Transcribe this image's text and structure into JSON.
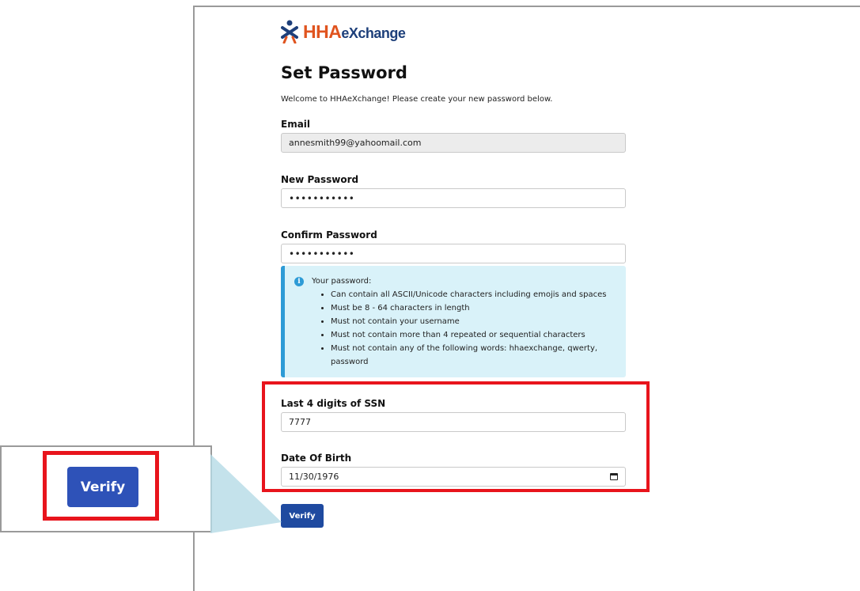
{
  "logo": {
    "part1": "HHA",
    "part2": "eXchange"
  },
  "page": {
    "title": "Set Password",
    "welcome": "Welcome to HHAeXchange! Please create your new password below."
  },
  "form": {
    "email_label": "Email",
    "email_value": "annesmith99@yahoomail.com",
    "new_password_label": "New Password",
    "new_password_value": "•••••••••••",
    "confirm_password_label": "Confirm Password",
    "confirm_password_value": "•••••••••••",
    "ssn_label": "Last 4 digits of SSN",
    "ssn_value": "7777",
    "dob_label": "Date Of Birth",
    "dob_value": "11/30/1976",
    "verify_label": "Verify"
  },
  "info": {
    "icon": "info-icon",
    "heading": "Your password:",
    "rules": [
      "Can contain all ASCII/Unicode characters including emojis and spaces",
      "Must be 8 - 64 characters in length",
      "Must not contain your username",
      "Must not contain more than 4 repeated or sequential characters",
      "Must not contain any of the following words: hhaexchange, qwerty, password"
    ]
  },
  "zoom": {
    "verify_label": "Verify"
  },
  "colors": {
    "brand_orange": "#e0541f",
    "brand_navy": "#1d3f7a",
    "button_blue": "#1f4aa0",
    "highlight_red": "#e8141c",
    "info_bg": "#d9f2f9",
    "info_accent": "#2d9bd6"
  }
}
